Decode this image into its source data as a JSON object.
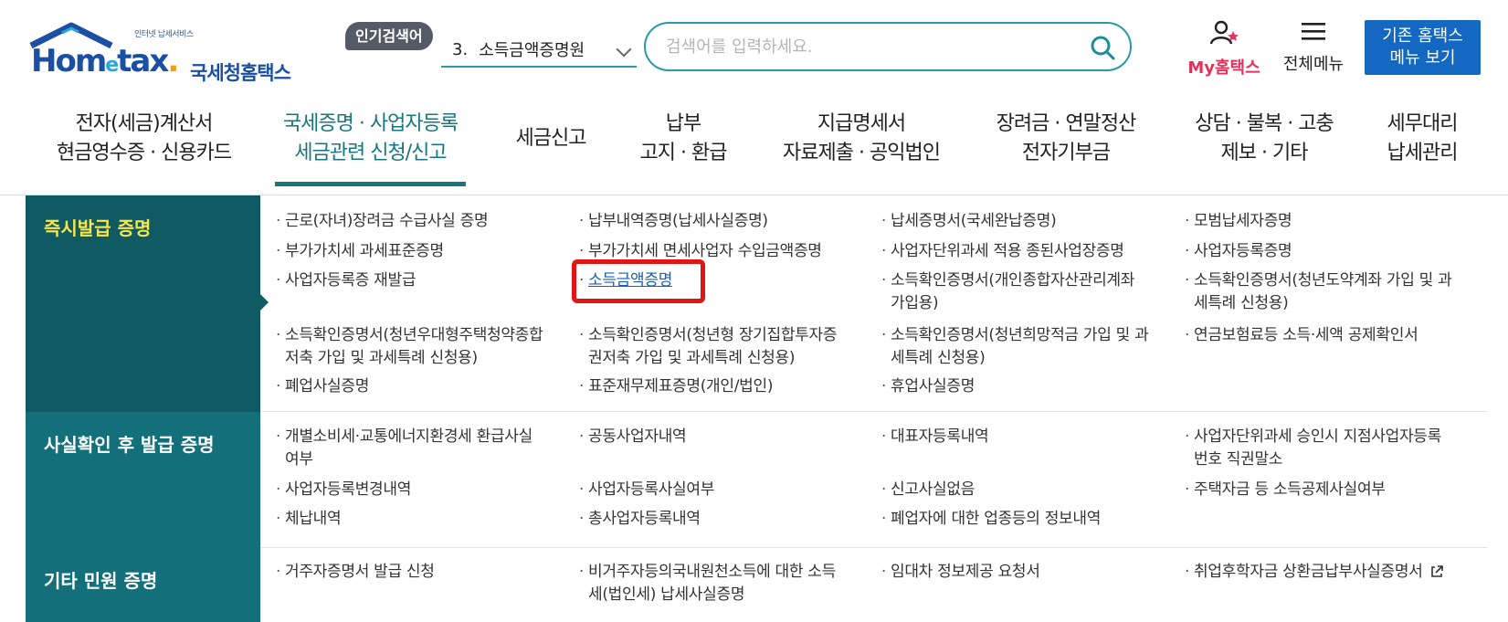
{
  "header": {
    "logo_small": "인터넷 납세서비스",
    "logo_word": "Hometax.",
    "logo_kor": "국세청홈택스",
    "popular_label": "인기검색어",
    "popular_rank": "3.",
    "popular_term": "소득금액증명원",
    "search_placeholder": "검색어를 입력하세요.",
    "my_label": "My홈택스",
    "allmenu_label": "전체메뉴",
    "classic_line1": "기존 홈택스",
    "classic_line2": "메뉴 보기"
  },
  "gnb": [
    {
      "line1": "전자(세금)계산서",
      "line2": "현금영수증 · 신용카드"
    },
    {
      "line1": "국세증명 · 사업자등록",
      "line2": "세금관련 신청/신고",
      "active": true
    },
    {
      "line1": "세금신고",
      "line2": ""
    },
    {
      "line1": "납부",
      "line2": "고지 · 환급"
    },
    {
      "line1": "지급명세서",
      "line2": "자료제출 · 공익법인"
    },
    {
      "line1": "장려금 · 연말정산",
      "line2": "전자기부금"
    },
    {
      "line1": "상담 · 불복 · 고충",
      "line2": "제보 · 기타"
    },
    {
      "line1": "세무대리",
      "line2": "납세관리"
    }
  ],
  "categories": [
    {
      "title": "즉시발급 증명"
    },
    {
      "title": "사실확인 후 발급 증명"
    },
    {
      "title": "기타 민원 증명"
    }
  ],
  "links": {
    "instant": [
      "근로(자녀)장려금 수급사실 증명",
      "납부내역증명(납세사실증명)",
      "납세증명서(국세완납증명)",
      "모범납세자증명",
      "부가가치세 과세표준증명",
      "부가가치세 면세사업자 수입금액증명",
      "사업자단위과세 적용 종된사업장증명",
      "사업자등록증명",
      "사업자등록증 재발급",
      "소득금액증명",
      "소득확인증명서(개인종합자산관리계좌",
      "가입용)",
      "소득확인증명서(청년도약계좌 가입 및 과",
      "세특례 신청용)",
      "소득확인증명서(청년우대형주택청약종합",
      "저축 가입 및 과세특례 신청용)",
      "소득확인증명서(청년형 장기집합투자증",
      "권저축 가입 및 과세특례 신청용)",
      "소득확인증명서(청년희망적금 가입 및 과",
      "세특례 신청용)",
      "연금보험료등 소득·세액 공제확인서",
      "폐업사실증명",
      "표준재무제표증명(개인/법인)",
      "휴업사실증명"
    ],
    "confirm": [
      "개별소비세·교통에너지환경세 환급사실",
      "여부",
      "공동사업자내역",
      "대표자등록내역",
      "사업자단위과세 승인시 지점사업자등록",
      "번호 직권말소",
      "사업자등록변경내역",
      "사업자등록사실여부",
      "신고사실없음",
      "주택자금 등 소득공제사실여부",
      "체납내역",
      "총사업자등록내역",
      "폐업자에 대한 업종등의 정보내역"
    ],
    "other": [
      "거주자증명서 발급 신청",
      "비거주자등의국내원천소득에 대한 소득",
      "세(법인세) 납세사실증명",
      "임대차 정보제공 요청서",
      "취업후학자금 상환금납부사실증명서"
    ]
  },
  "colors": {
    "teal_dark": "#0f5a63",
    "teal": "#13707b",
    "active_menu": "#17777f",
    "highlight_box": "#e01515",
    "classic_button": "#1568c2"
  }
}
